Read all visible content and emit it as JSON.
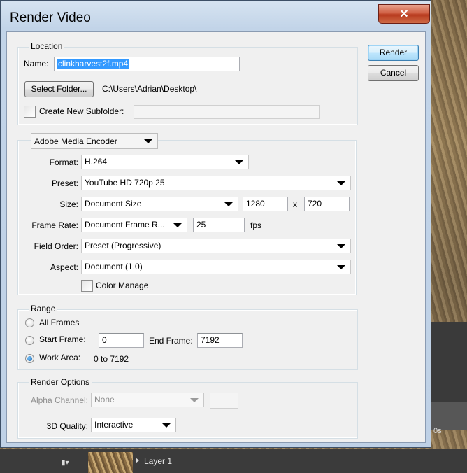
{
  "background": {
    "timecode": "0s",
    "layer_label": "Layer 1"
  },
  "dialog": {
    "title": "Render Video",
    "close_glyph": "✕",
    "buttons": {
      "render": "Render",
      "cancel": "Cancel"
    }
  },
  "location": {
    "group_title": "Location",
    "name_label": "Name:",
    "name_value": "clinkharvest2f.mp4",
    "select_folder_button": "Select Folder...",
    "folder_path": "C:\\Users\\Adrian\\Desktop\\",
    "create_subfolder_label": "Create New Subfolder:",
    "create_subfolder_checked": false,
    "subfolder_value": ""
  },
  "encoder": {
    "engine": "Adobe Media Encoder",
    "format_label": "Format:",
    "format_value": "H.264",
    "preset_label": "Preset:",
    "preset_value": "YouTube HD 720p 25",
    "size_label": "Size:",
    "size_value": "Document Size",
    "width": "1280",
    "size_separator": "x",
    "height": "720",
    "frame_rate_label": "Frame Rate:",
    "frame_rate_value": "Document Frame R...",
    "fps_value": "25",
    "fps_unit": "fps",
    "field_order_label": "Field Order:",
    "field_order_value": "Preset (Progressive)",
    "aspect_label": "Aspect:",
    "aspect_value": "Document (1.0)",
    "color_manage_label": "Color Manage",
    "color_manage_checked": false
  },
  "range": {
    "group_title": "Range",
    "all_frames_label": "All Frames",
    "start_frame_label": "Start Frame:",
    "start_frame_value": "0",
    "end_frame_label": "End Frame:",
    "end_frame_value": "7192",
    "work_area_label": "Work Area:",
    "work_area_value": "0 to 7192",
    "selected": "work_area"
  },
  "render_options": {
    "group_title": "Render Options",
    "alpha_channel_label": "Alpha Channel:",
    "alpha_channel_value": "None",
    "quality_label": "3D Quality:",
    "quality_value": "Interactive"
  },
  "colors": {
    "selection_highlight": "#3399ff",
    "close_button": "#c84b2e",
    "radio_selected": "#0f5fa8"
  }
}
